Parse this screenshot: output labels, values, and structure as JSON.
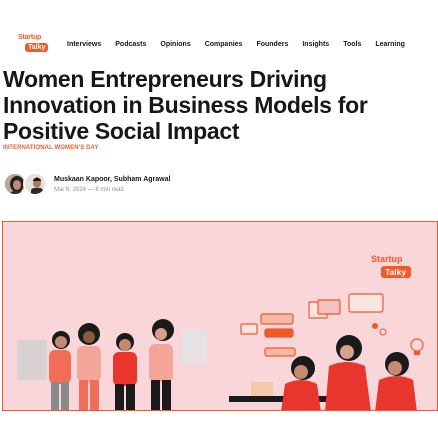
{
  "header": {
    "logo": {
      "line1": "Startup",
      "line2": "Talky"
    },
    "nav": [
      "Interviews",
      "Podcasts",
      "Opinions",
      "Companies",
      "Founders",
      "Insights",
      "Tools",
      "Learning"
    ]
  },
  "article": {
    "title": "Women Entrepreneurs Driving Innovation in Business Models for Positive Social Impact",
    "tag": "INTERNATIONAL WOMEN'S DAY",
    "authors": "Muskaan Kapoor, Subham Agrawal",
    "meta": "Mar 6, 2024 — 6 min read"
  },
  "hero": {
    "logo": {
      "line1": "Startup",
      "line2": "Talky"
    }
  },
  "colors": {
    "accent": "#f05a28",
    "hero_bg": "#f8d6d9",
    "figure_red": "#e8362f"
  }
}
